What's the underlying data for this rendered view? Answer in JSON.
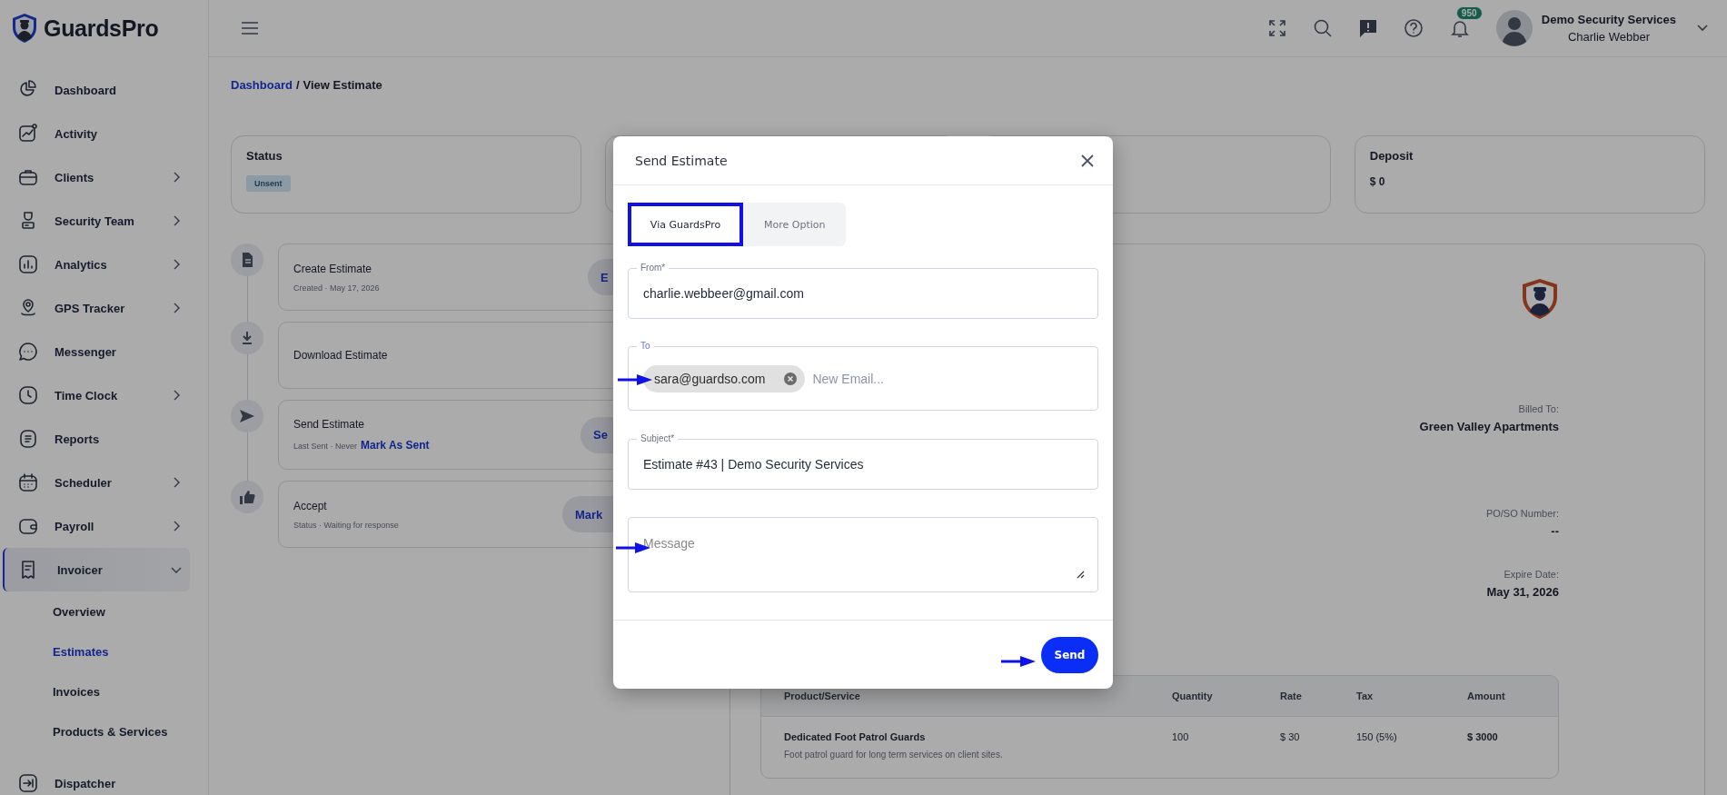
{
  "brand": {
    "name": "GuardsPro"
  },
  "sidebar": {
    "items": [
      {
        "label": "Dashboard",
        "kind": "link",
        "selected": false
      },
      {
        "label": "Activity",
        "kind": "link",
        "selected": false
      },
      {
        "label": "Clients",
        "kind": "group",
        "expanded": false,
        "selected": false
      },
      {
        "label": "Security Team",
        "kind": "group",
        "expanded": false,
        "selected": false
      },
      {
        "label": "Analytics",
        "kind": "group",
        "expanded": false,
        "selected": false
      },
      {
        "label": "GPS Tracker",
        "kind": "group",
        "expanded": false,
        "selected": false
      },
      {
        "label": "Messenger",
        "kind": "link",
        "selected": false
      },
      {
        "label": "Time Clock",
        "kind": "group",
        "expanded": false,
        "selected": false
      },
      {
        "label": "Reports",
        "kind": "link",
        "selected": false
      },
      {
        "label": "Scheduler",
        "kind": "group",
        "expanded": false,
        "selected": false
      },
      {
        "label": "Payroll",
        "kind": "group",
        "expanded": false,
        "selected": false
      },
      {
        "label": "Invoicer",
        "kind": "group",
        "expanded": true,
        "selected": true,
        "children": [
          {
            "label": "Overview",
            "selected": false
          },
          {
            "label": "Estimates",
            "selected": true
          },
          {
            "label": "Invoices",
            "selected": false
          },
          {
            "label": "Products & Services",
            "selected": false
          }
        ]
      },
      {
        "label": "Dispatcher",
        "kind": "link",
        "selected": false
      }
    ]
  },
  "header": {
    "notification_count": "950",
    "account": {
      "company": "Demo Security Services",
      "user": "Charlie Webber"
    }
  },
  "breadcrumb": {
    "items": [
      "Dashboard",
      "View Estimate"
    ],
    "separator": "/"
  },
  "summary_cards": [
    {
      "title": "Status",
      "badge": "Unsent"
    },
    {
      "title": "Deposit",
      "value": "$ 0"
    }
  ],
  "timeline": [
    {
      "title": "Create Estimate",
      "detail": "Created · May 17, 2026",
      "action": "E"
    },
    {
      "title": "Download Estimate"
    },
    {
      "title": "Send Estimate",
      "detail": "Last Sent · Never",
      "link": "Mark As Sent",
      "action": "Se"
    },
    {
      "title": "Accept",
      "detail": "Status · Waiting for response",
      "action": "Mark"
    }
  ],
  "estimate": {
    "billed_to_label": "Billed To:",
    "billed_to": "Green Valley Apartments",
    "po_label": "PO/SO Number:",
    "po_value": "--",
    "expire_label": "Expire Date:",
    "expire_value": "May 31, 2026",
    "table": {
      "columns": [
        "Product/Service",
        "Quantity",
        "Rate",
        "Tax",
        "Amount"
      ],
      "rows": [
        {
          "product": "Dedicated Foot Patrol Guards",
          "description": "Foot patrol guard for long term services on client sites.",
          "quantity": "100",
          "rate": "$ 30",
          "tax": "150 (5%)",
          "amount": "$ 3000"
        }
      ]
    }
  },
  "modal": {
    "title": "Send Estimate",
    "tabs": [
      {
        "label": "Via GuardsPro",
        "selected": true
      },
      {
        "label": "More Option",
        "selected": false
      }
    ],
    "from": {
      "label": "From*",
      "value": "charlie.webbeer@gmail.com"
    },
    "to": {
      "label": "To",
      "chips": [
        "sara@guardso.com"
      ],
      "placeholder": "New Email..."
    },
    "subject": {
      "label": "Subject*",
      "value": "Estimate #43 | Demo Security Services"
    },
    "message": {
      "placeholder": "Message"
    },
    "send_button": "Send"
  }
}
